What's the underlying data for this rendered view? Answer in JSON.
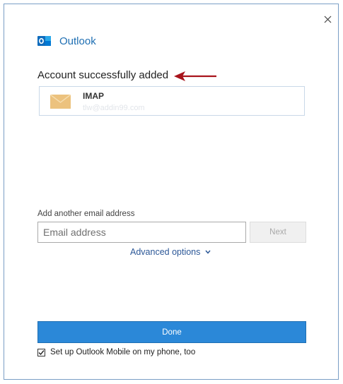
{
  "app": {
    "name": "Outlook"
  },
  "status": {
    "title": "Account successfully added"
  },
  "account": {
    "type": "IMAP",
    "email": "tlw@addin99.com"
  },
  "add_email": {
    "label": "Add another email address",
    "placeholder": "Email address",
    "value": "",
    "next_label": "Next"
  },
  "advanced_options_label": "Advanced options",
  "done_label": "Done",
  "mobile_option": {
    "label": "Set up Outlook Mobile on my phone, too",
    "checked": true
  },
  "colors": {
    "accent": "#2b88d8",
    "brand": "#0f6cbd",
    "annotation_arrow": "#a8141c",
    "envelope": "#ecc27e"
  },
  "icons": {
    "close": "close-icon",
    "logo": "outlook-logo-icon",
    "envelope": "envelope-icon",
    "chevron": "chevron-down-icon",
    "annotation": "arrow-left-icon",
    "check": "check-icon"
  }
}
